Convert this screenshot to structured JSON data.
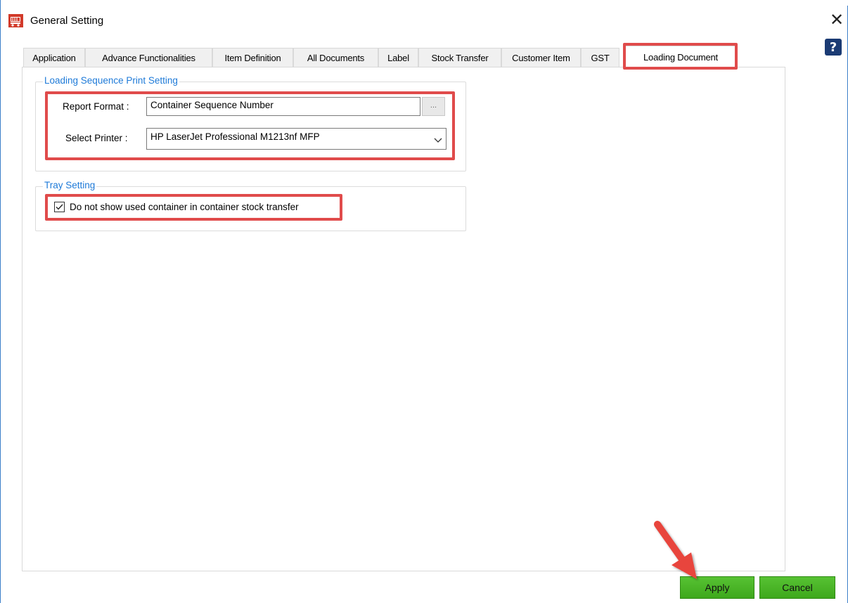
{
  "window": {
    "title": "General Setting"
  },
  "icons": {
    "app": "shopping-cart-icon",
    "close": "close-icon",
    "help": "help-icon",
    "dropdown": "chevron-down-icon",
    "check": "checkmark-icon",
    "annotation_arrow": "arrow-icon"
  },
  "tabs": [
    {
      "label": "Application"
    },
    {
      "label": "Advance Functionalities"
    },
    {
      "label": "Item Definition"
    },
    {
      "label": "All Documents"
    },
    {
      "label": "Label"
    },
    {
      "label": "Stock Transfer"
    },
    {
      "label": "Customer Item"
    },
    {
      "label": "GST"
    },
    {
      "label": "Loading Document",
      "active": true
    }
  ],
  "help_label": "?",
  "close_label": "✕",
  "loading_sequence": {
    "legend": "Loading Sequence Print Setting",
    "report_format_label": "Report Format :",
    "report_format_value": "Container Sequence Number",
    "browse_label": "...",
    "select_printer_label": "Select Printer :",
    "select_printer_value": "HP LaserJet Professional M1213nf MFP"
  },
  "tray_setting": {
    "legend": "Tray Setting",
    "checkbox_label": "Do not show used container in container stock transfer",
    "checked": true
  },
  "buttons": {
    "apply": "Apply",
    "cancel": "Cancel"
  },
  "colors": {
    "accent_blue": "#1e7ad8",
    "highlight_red": "#e04b4b",
    "button_green": "#4cb62a",
    "help_bg": "#1b3b74"
  }
}
